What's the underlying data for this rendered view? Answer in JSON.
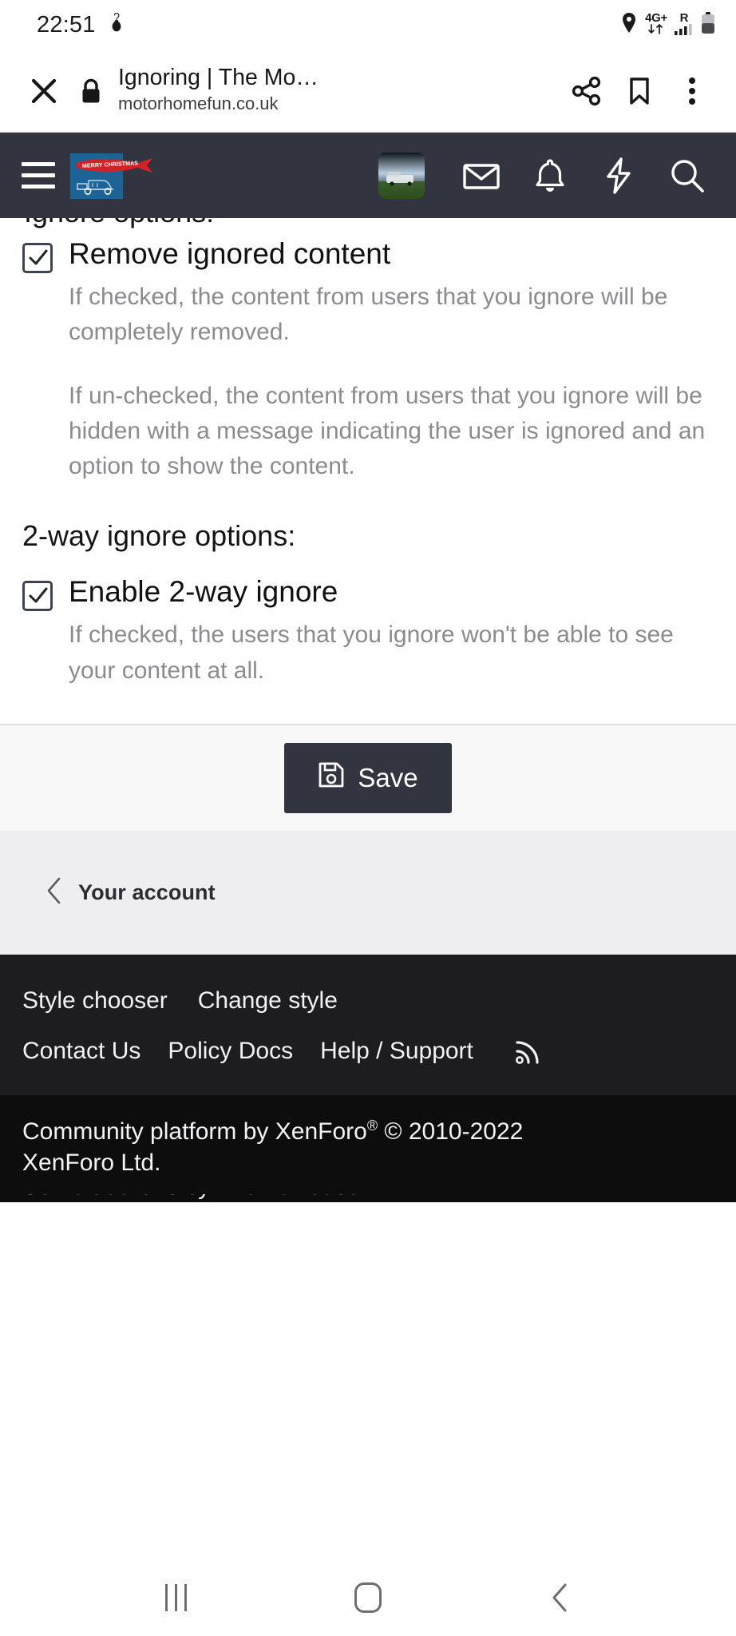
{
  "status_bar": {
    "time": "22:51",
    "left_icons": [
      "do-not-disturb-icon"
    ],
    "network_label": "4G+",
    "roaming_label": "R",
    "right_icons": [
      "location-icon",
      "data-transfer-icon",
      "signal-bars-icon",
      "battery-icon"
    ]
  },
  "browser": {
    "close_label": "✕",
    "page_title": "Ignoring | The Mo…",
    "host": "motorhomefun.co.uk",
    "icons": {
      "lock": "lock-icon",
      "share": "share-icon",
      "bookmark": "bookmark-icon",
      "overflow": "more-vertical-icon"
    }
  },
  "navbar": {
    "menu_icon": "hamburger-menu-icon",
    "logo_alt": "motorhomefun-logo",
    "logo_banner_text": "MERRY CHRISTMAS",
    "avatar_alt": "user-avatar",
    "icons": [
      {
        "name": "inbox-icon",
        "label": "Inbox"
      },
      {
        "name": "bell-icon",
        "label": "Alerts"
      },
      {
        "name": "lightning-icon",
        "label": "What's new"
      },
      {
        "name": "search-icon",
        "label": "Search"
      }
    ]
  },
  "content": {
    "clipped_heading": "Ignore options:",
    "options": [
      {
        "label": "Remove ignored content",
        "checked": true,
        "hints": [
          "If checked, the content from users that you ignore will be completely removed.",
          "If un-checked, the content from users that you ignore will be hidden with a message indicating the user is ignored and an option to show the content."
        ]
      }
    ],
    "section_heading": "2-way ignore options:",
    "options_2way": [
      {
        "label": "Enable 2-way ignore",
        "checked": true,
        "hints": [
          "If checked, the users that you ignore won't be able to see your content at all."
        ]
      }
    ],
    "save_button": {
      "label": "Save",
      "icon": "floppy-disk-icon"
    }
  },
  "breadcrumb": {
    "back_icon": "chevron-left-icon",
    "label": "Your account"
  },
  "footer": {
    "row1": [
      {
        "label": "Style chooser",
        "name": "style-chooser-link"
      },
      {
        "label": "Change style",
        "name": "change-style-link"
      }
    ],
    "row2": [
      {
        "label": "Contact Us",
        "name": "contact-us-link"
      },
      {
        "label": "Policy Docs",
        "name": "policy-docs-link"
      },
      {
        "label": "Help / Support",
        "name": "help-support-link"
      }
    ],
    "rss_icon": "rss-icon",
    "copyright_line1": "Community platform by XenForo",
    "copyright_reg": "®",
    "copyright_line1_tail": " © 2010-2022",
    "copyright_line2": "XenForo Ltd.",
    "copyright_clipped": "Some add-ons by ThemeHouse"
  },
  "system_nav": {
    "recents": "recents-icon",
    "home": "home-icon",
    "back": "back-icon"
  },
  "colors": {
    "navbar_bg": "#32353f",
    "footer_bg": "#1d1d1f",
    "copyright_bg": "#0d0d0e",
    "accent": "#1d6396",
    "banner_red": "#d42027",
    "hint_text": "#8b8b90",
    "breadcrumb_bg": "#eeeef0",
    "save_bar_bg": "#f8f8f9"
  }
}
